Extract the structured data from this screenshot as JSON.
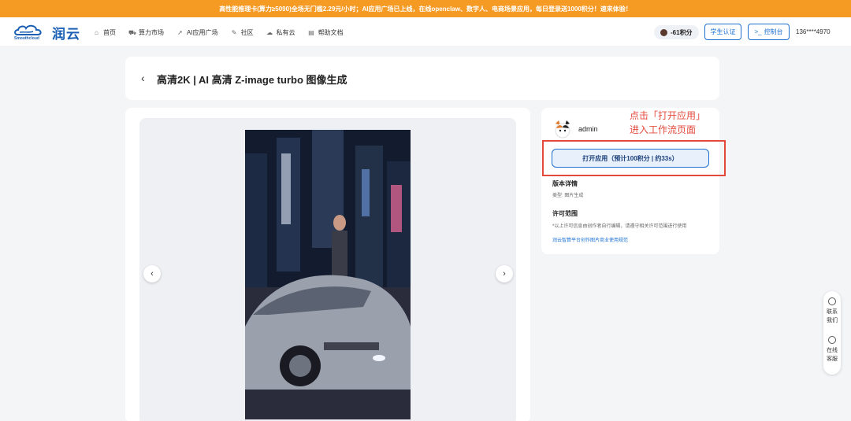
{
  "banner": {
    "text": "高性能推理卡(算力≥5090)全场无门槛2.29元/小时；AI应用广场已上线，在线openclaw、数字人、电商场景应用，每日登录送1000积分！速来体验！"
  },
  "header": {
    "logo_sub": "Smoothcloud",
    "logo_text": "润云",
    "nav": [
      {
        "label": "首页",
        "icon": "home-icon"
      },
      {
        "label": "算力市场",
        "icon": "cart-icon"
      },
      {
        "label": "AI应用广场",
        "icon": "rocket-icon"
      },
      {
        "label": "社区",
        "icon": "tag-icon"
      },
      {
        "label": "私有云",
        "icon": "cloud-icon"
      },
      {
        "label": "帮助文档",
        "icon": "book-icon"
      }
    ],
    "points": "-61积分",
    "student_label": "学生认证",
    "console_label": "控制台",
    "user": "136****4970"
  },
  "page": {
    "title": "高清2K | AI 高清 Z-image turbo 图像生成"
  },
  "sidebar": {
    "author": "admin",
    "open_button": "打开应用（预计100积分 | 约33s）",
    "version_title": "版本详情",
    "version_text": "类型: 图片生成",
    "license_title": "许可范围",
    "license_text": "*以上许可信息由创作者自行编辑，请遵守相关许可范围进行使用",
    "license_link": "润云智算平台创作图片商业使用规范"
  },
  "annotation": {
    "line1": "点击「打开应用」",
    "line2": "进入工作流页面"
  },
  "float": {
    "contact": "联系我们",
    "service": "在线客服"
  },
  "colors": {
    "accent": "#1a6fd1",
    "banner": "#f59a23",
    "annotation": "#e44a3c"
  }
}
